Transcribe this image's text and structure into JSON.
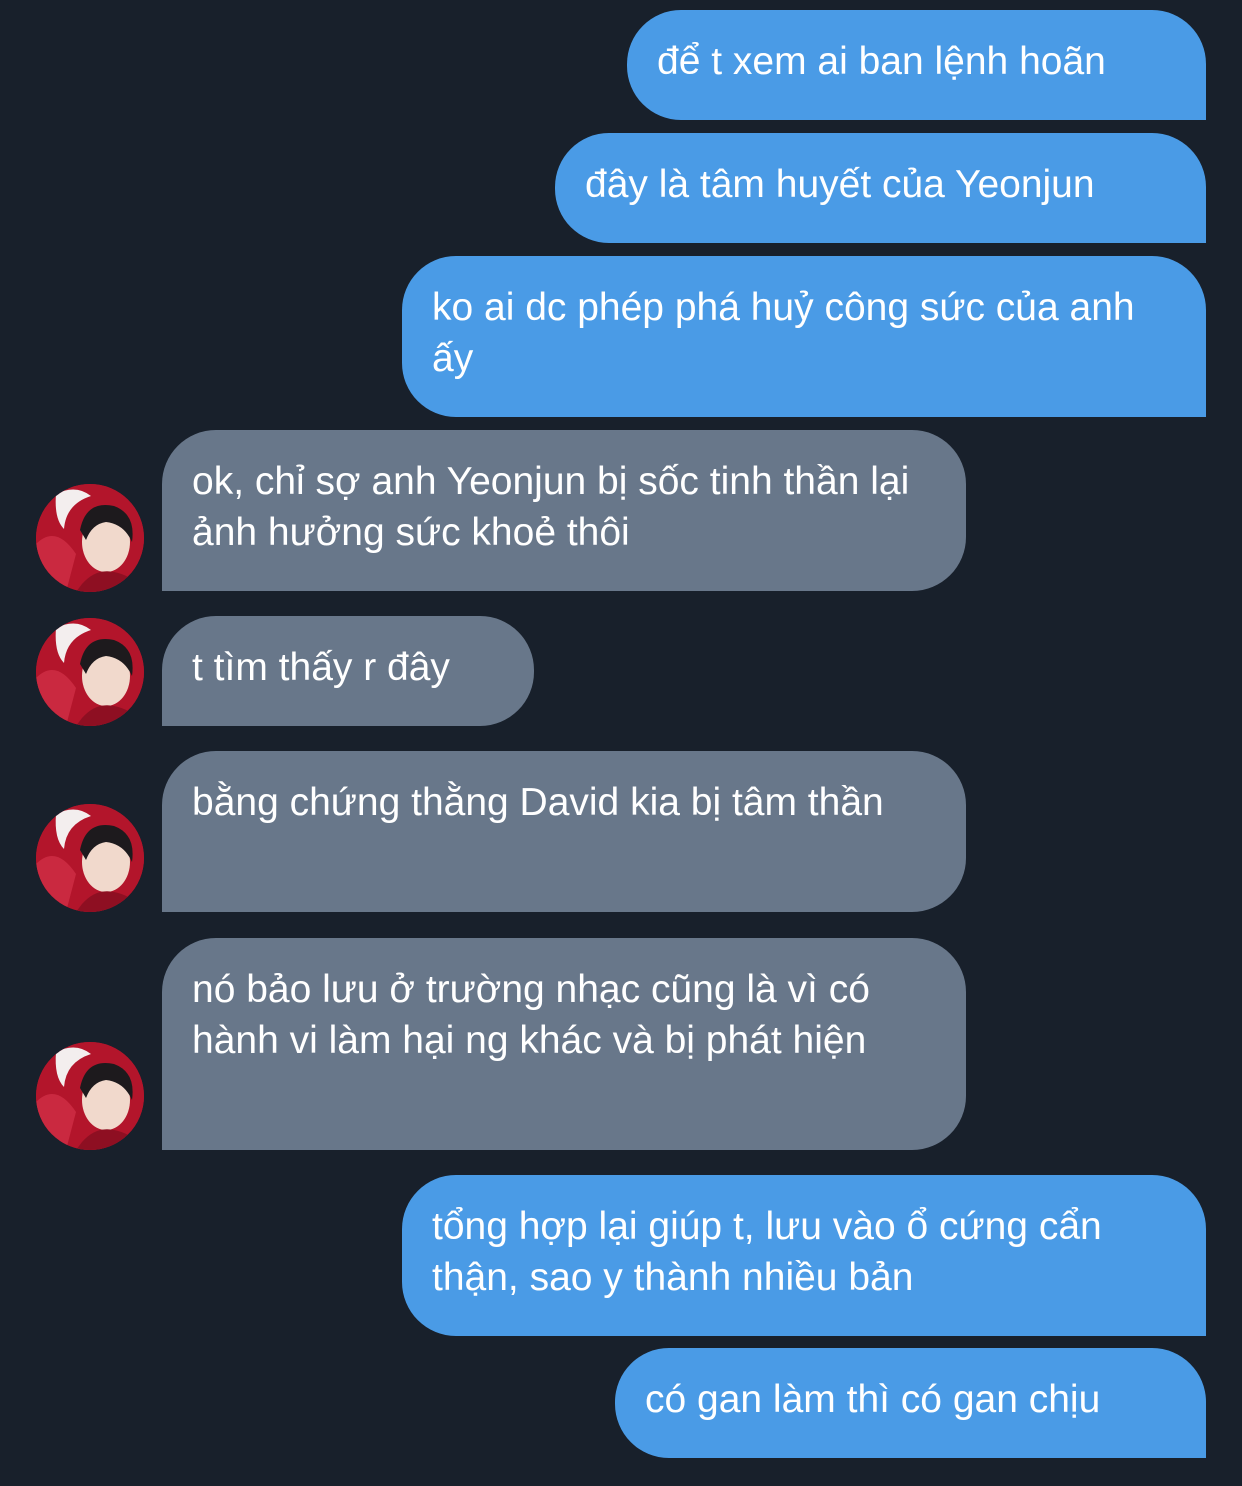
{
  "messages": [
    {
      "sender": "me",
      "text": "để t xem ai ban lệnh hoãn"
    },
    {
      "sender": "me",
      "text": "đây là tâm huyết của Yeonjun"
    },
    {
      "sender": "me",
      "text": "ko ai dc phép phá huỷ công sức của anh ấy"
    },
    {
      "sender": "other",
      "text": "ok, chỉ sợ anh Yeonjun bị sốc tinh thần lại ảnh hưởng sức khoẻ thôi"
    },
    {
      "sender": "other",
      "text": "t tìm thấy r đây"
    },
    {
      "sender": "other",
      "text": "bằng chứng thằng David kia bị tâm thần"
    },
    {
      "sender": "other",
      "text": "nó bảo lưu ở trường nhạc cũng là vì có hành vi làm hại ng khác và bị phát hiện"
    },
    {
      "sender": "me",
      "text": "tổng hợp lại giúp t, lưu vào ổ cứng cẩn thận, sao y thành nhiều bản"
    },
    {
      "sender": "me",
      "text": "có gan làm thì có gan chịu"
    }
  ],
  "colors": {
    "background": "#18202b",
    "sent_bubble": "#4a9be6",
    "received_bubble": "#68778a",
    "text": "#ffffff"
  },
  "avatar_icon": "contact-avatar-photo"
}
